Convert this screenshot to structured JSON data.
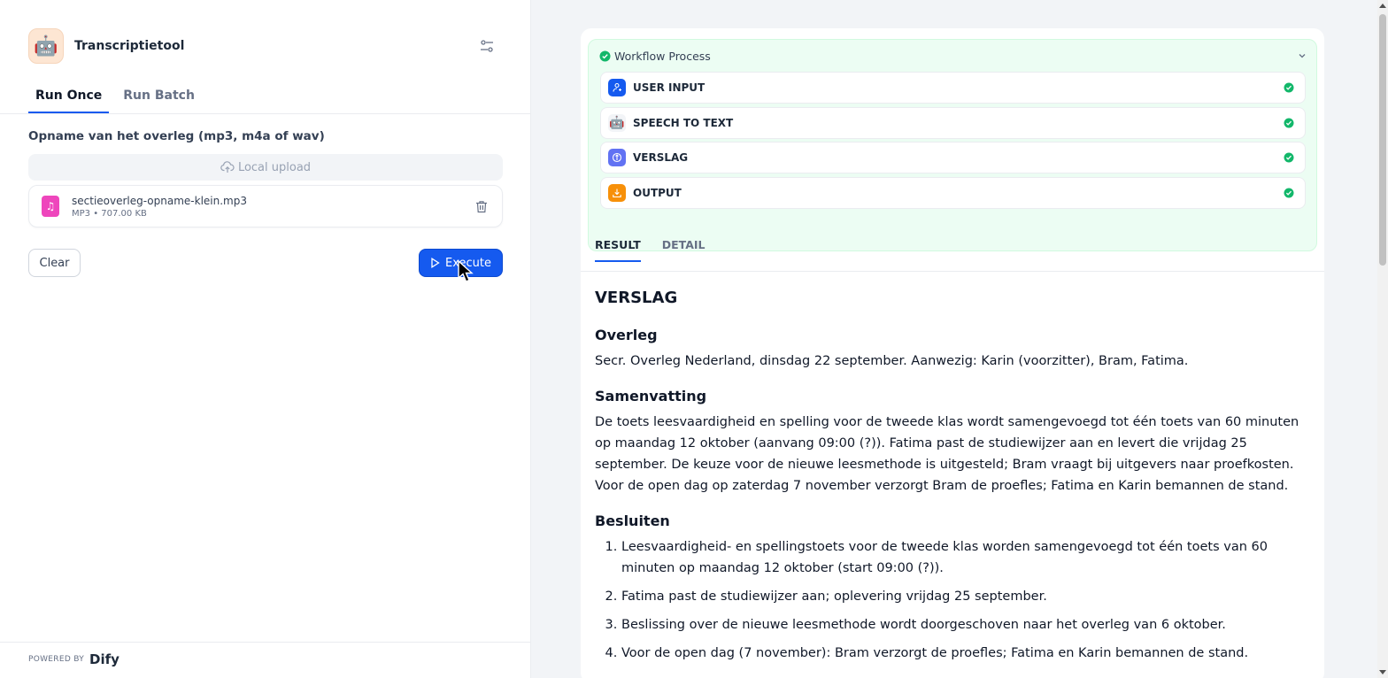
{
  "app": {
    "title": "Transcriptietool",
    "icon": "robot-emoji"
  },
  "tabs": {
    "run_once": "Run Once",
    "run_batch": "Run Batch"
  },
  "form": {
    "field_label": "Opname van het overleg (mp3, m4a of wav)",
    "upload_label": "Local upload",
    "file": {
      "name": "sectieoverleg-opname-klein.mp3",
      "info": "MP3 • 707.00 KB"
    },
    "clear_label": "Clear",
    "execute_label": "Execute"
  },
  "footer": {
    "powered_by": "POWERED BY",
    "brand": "Dify"
  },
  "workflow": {
    "title": "Workflow Process",
    "status_color": "#12b76a",
    "nodes": [
      {
        "label": "USER INPUT",
        "icon": "user-input-icon",
        "color": "#155aef"
      },
      {
        "label": "SPEECH TO TEXT",
        "icon": "robot-icon",
        "color": "#f2f4f7"
      },
      {
        "label": "VERSLAG",
        "icon": "llm-icon",
        "color": "#6172f3"
      },
      {
        "label": "OUTPUT",
        "icon": "output-icon",
        "color": "#f79009"
      }
    ]
  },
  "result_tabs": {
    "result": "RESULT",
    "detail": "DETAIL"
  },
  "document": {
    "title": "VERSLAG",
    "overleg_heading": "Overleg",
    "overleg_text": "Secr. Overleg Nederland, dinsdag 22 september. Aanwezig: Karin (voorzitter), Bram, Fatima.",
    "samenvatting_heading": "Samenvatting",
    "samenvatting_text": "De toets leesvaardigheid en spelling voor de tweede klas wordt samengevoegd tot één toets van 60 minuten op maandag 12 oktober (aanvang 09:00 (?)). Fatima past de studiewijzer aan en levert die vrijdag 25 september. De keuze voor de nieuwe leesmethode is uitgesteld; Bram vraagt bij uitgevers naar proefkosten. Voor de open dag op zaterdag 7 november verzorgt Bram de proefles; Fatima en Karin bemannen de stand.",
    "besluiten_heading": "Besluiten",
    "besluiten": [
      "Leesvaardigheid- en spellingstoets voor de tweede klas worden samengevoegd tot één toets van 60 minuten op maandag 12 oktober (start 09:00 (?)).",
      "Fatima past de studiewijzer aan; oplevering vrijdag 25 september.",
      "Beslissing over de nieuwe leesmethode wordt doorgeschoven naar het overleg van 6 oktober.",
      "Voor de open dag (7 november): Bram verzorgt de proefles; Fatima en Karin bemannen de stand."
    ]
  }
}
